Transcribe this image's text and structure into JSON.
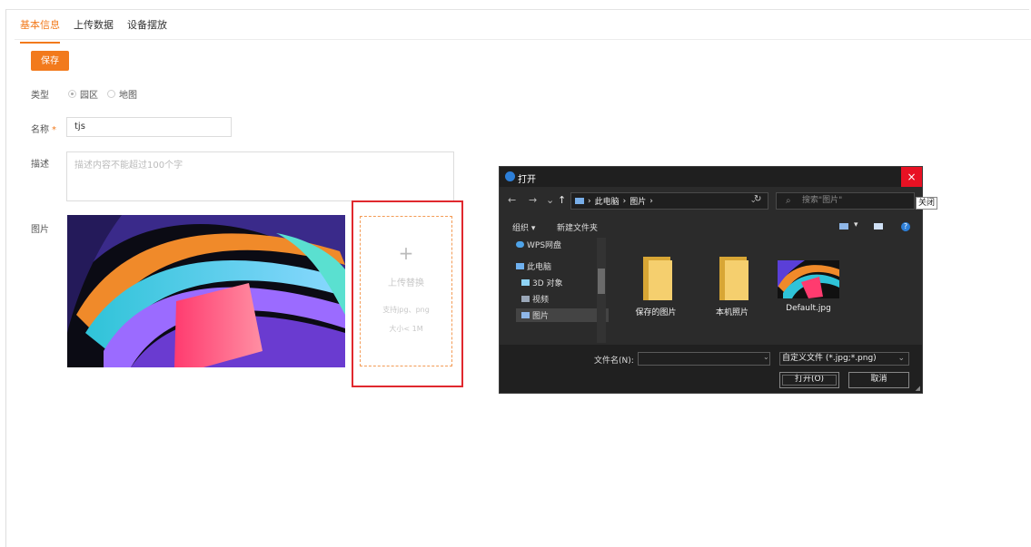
{
  "tabs": [
    {
      "label": "基本信息",
      "active": true
    },
    {
      "label": "上传数据",
      "active": false
    },
    {
      "label": "设备摆放",
      "active": false
    }
  ],
  "form": {
    "save_label": "保存",
    "type_label": "类型",
    "type_options": [
      {
        "label": "园区",
        "checked": true
      },
      {
        "label": "地图",
        "checked": false
      }
    ],
    "name_label": "名称",
    "name_required_mark": "*",
    "name_value": "tjs",
    "desc_label": "描述",
    "desc_placeholder": "描述内容不能超过100个字",
    "image_label": "图片"
  },
  "upload": {
    "plus": "+",
    "title": "上传替换",
    "hint_format": "支持jpg、png",
    "hint_size": "大小< 1M"
  },
  "dialog": {
    "title": "打开",
    "close_symbol": "×",
    "close_tooltip": "关闭",
    "nav_back": "←",
    "nav_forward": "→",
    "nav_recent": "⌄",
    "nav_up": "↑",
    "breadcrumb": [
      "此电脑",
      "图片"
    ],
    "search_placeholder": "搜索\"图片\"",
    "toolbar_organize": "组织 ▾",
    "toolbar_new_folder": "新建文件夹",
    "tree": [
      {
        "label": "WPS网盘",
        "icon": "cloud-icon"
      },
      {
        "label": "此电脑",
        "icon": "computer-icon"
      },
      {
        "label": "3D 对象",
        "icon": "cube-icon"
      },
      {
        "label": "视频",
        "icon": "video-icon"
      },
      {
        "label": "图片",
        "icon": "pictures-icon",
        "selected": true
      }
    ],
    "files": [
      {
        "name": "保存的图片",
        "kind": "folder"
      },
      {
        "name": "本机照片",
        "kind": "folder"
      },
      {
        "name": "Default.jpg",
        "kind": "image"
      }
    ],
    "filename_label": "文件名(N):",
    "filename_value": "",
    "filetype": "自定义文件 (*.jpg;*.png)",
    "open_label": "打开(O)",
    "cancel_label": "取消"
  },
  "colors": {
    "accent": "#f27a1c",
    "highlight_border": "#e0282e",
    "dialog_bg": "#2b2b2b",
    "close_red": "#e81123"
  }
}
